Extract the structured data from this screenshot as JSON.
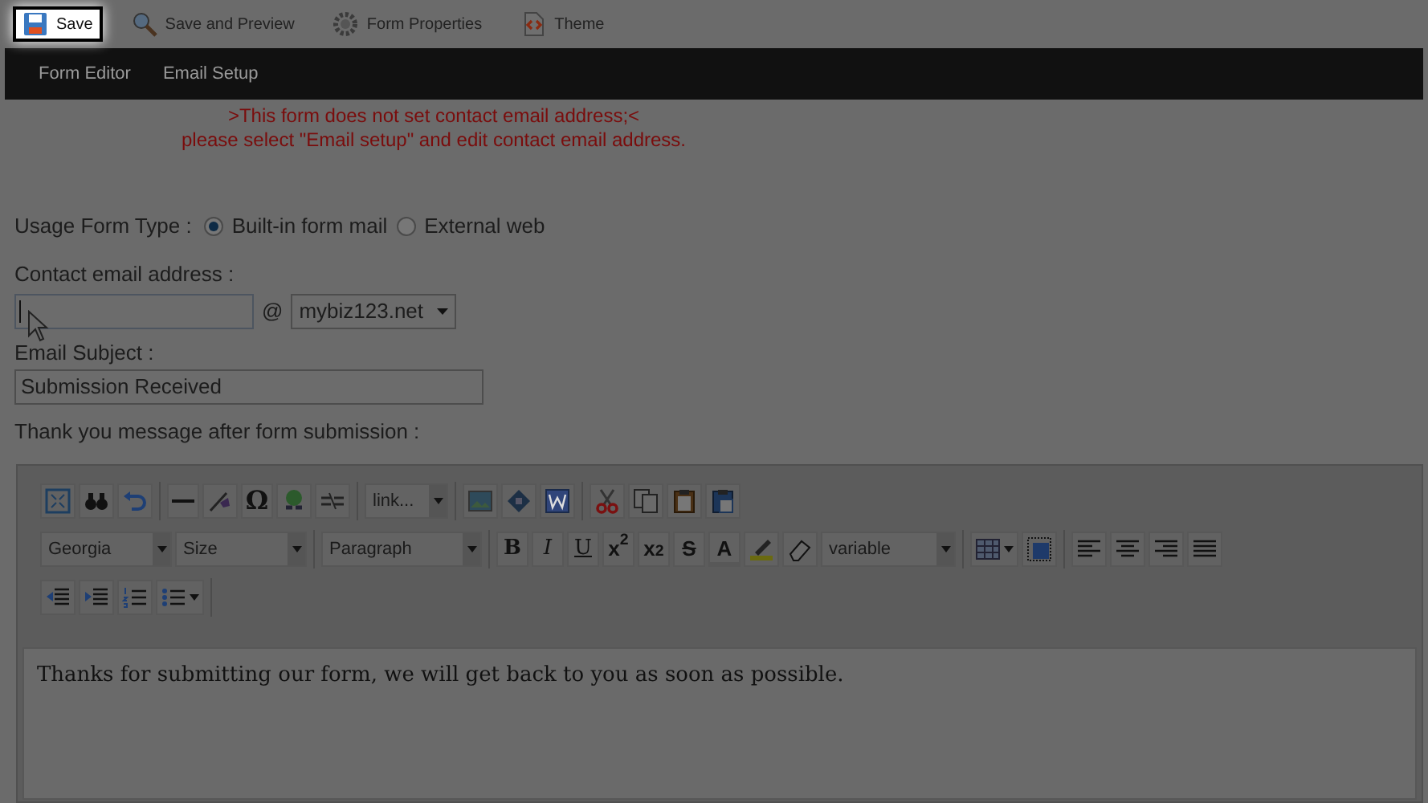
{
  "toolbar": [
    {
      "label": "Save",
      "highlighted": true
    },
    {
      "label": "Save and Preview",
      "highlighted": false
    },
    {
      "label": "Form Properties",
      "highlighted": false
    },
    {
      "label": "Theme",
      "highlighted": false
    }
  ],
  "nav": [
    {
      "label": "Form Editor"
    },
    {
      "label": "Email Setup"
    }
  ],
  "warning": [
    ">This form does not set contact email address;<",
    "please select \"Email setup\" and edit contact email address."
  ],
  "usage_form_type": {
    "label": "Usage Form Type :",
    "options": [
      {
        "label": "Built-in form mail",
        "selected": true
      },
      {
        "label": "External web",
        "selected": false
      }
    ]
  },
  "contact_email": {
    "label": "Contact email address :",
    "at": "@",
    "domain": "mybiz123.net"
  },
  "email_subject": {
    "label": "Email Subject :",
    "value": "Submission Received"
  },
  "thank_you": {
    "label": "Thank you message after form submission :",
    "editor_selects": [
      "link...",
      "Georgia",
      "Size",
      "Paragraph",
      "variable"
    ],
    "editor_glyphs": [
      "Ω",
      "B",
      "I",
      "U",
      "x$^{2}$",
      "x$_{2}$",
      "S",
      "A"
    ],
    "content": "Thanks for submitting our form, we will get back to you as soon as possible."
  }
}
